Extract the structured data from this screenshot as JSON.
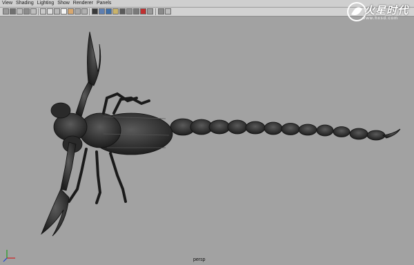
{
  "menu": {
    "items": [
      "View",
      "Shading",
      "Lighting",
      "Show",
      "Renderer",
      "Panels"
    ]
  },
  "toolbar": {
    "icons": [
      "select-camera-icon",
      "camera-attrs-icon",
      "bookmark-icon",
      "image-plane-icon",
      "grid-icon",
      "wireframe-icon",
      "smooth-shade-icon",
      "textured-icon",
      "light-icon",
      "shadow-icon",
      "xray-icon",
      "isolate-icon",
      "hud-icon",
      "resolution-gate-icon",
      "film-gate-icon",
      "field-chart-icon",
      "safe-action-icon",
      "safe-title-icon",
      "shaded-box-icon",
      "bounding-box-icon",
      "red-sphere-icon",
      "camera-icon",
      "layout-icon"
    ]
  },
  "viewport": {
    "camera_label": "persp",
    "subject": "scorpion model"
  },
  "watermark": {
    "title": "火星时代",
    "url": "www.hxsd.com"
  },
  "colors": {
    "viewport_bg": "#a2a2a2",
    "menubar_bg": "#cfcfcf",
    "axis_x": "#d02020",
    "axis_y": "#20a020",
    "axis_z": "#2040d0"
  }
}
